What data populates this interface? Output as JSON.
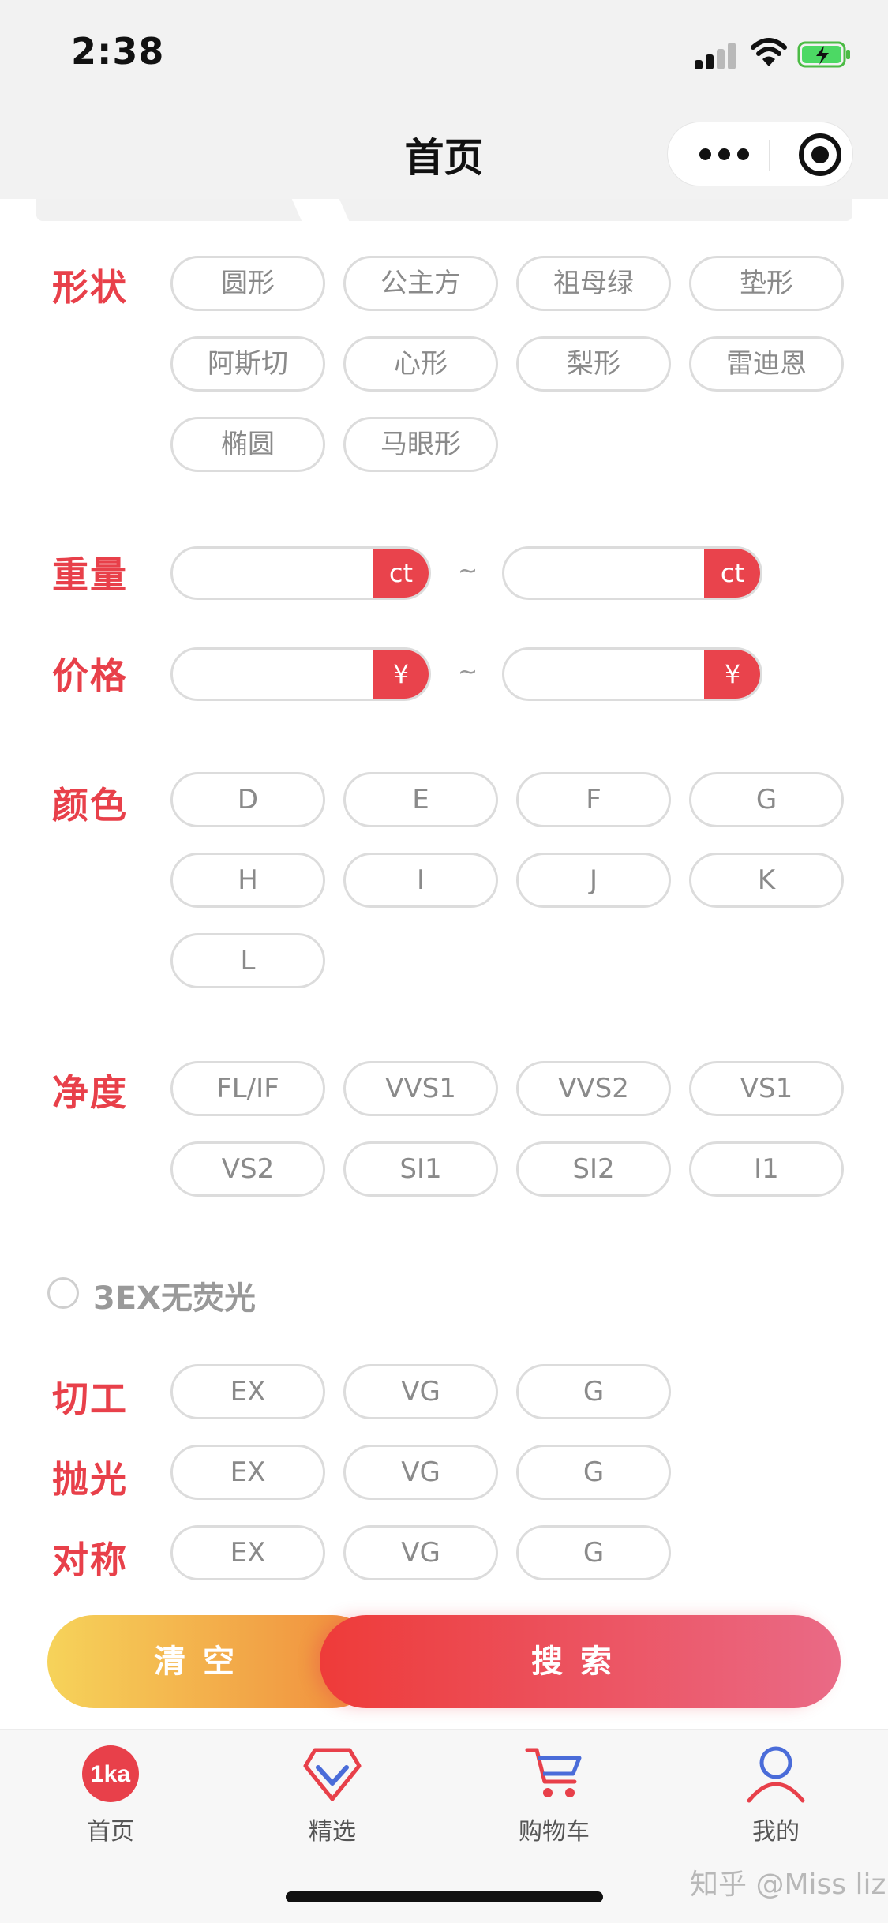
{
  "status_bar": {
    "time": "2:38"
  },
  "nav": {
    "title": "首页"
  },
  "sections": {
    "shape": {
      "label": "形状",
      "options": [
        "圆形",
        "公主方",
        "祖母绿",
        "垫形",
        "阿斯切",
        "心形",
        "梨形",
        "雷迪恩",
        "椭圆",
        "马眼形"
      ]
    },
    "weight": {
      "label": "重量",
      "unit": "ct",
      "separator": "~"
    },
    "price": {
      "label": "价格",
      "unit": "¥",
      "separator": "~"
    },
    "color": {
      "label": "颜色",
      "options": [
        "D",
        "E",
        "F",
        "G",
        "H",
        "I",
        "J",
        "K",
        "L"
      ]
    },
    "clarity": {
      "label": "净度",
      "options": [
        "FL/IF",
        "VVS1",
        "VVS2",
        "VS1",
        "VS2",
        "SI1",
        "SI2",
        "I1"
      ]
    },
    "fluorescence": {
      "label": "3EX无荧光"
    },
    "cut": {
      "label": "切工",
      "options": [
        "EX",
        "VG",
        "G"
      ]
    },
    "polish": {
      "label": "抛光",
      "options": [
        "EX",
        "VG",
        "G"
      ]
    },
    "symmetry": {
      "label": "对称",
      "options": [
        "EX",
        "VG",
        "G"
      ]
    }
  },
  "actions": {
    "clear": "清空",
    "search": "搜索"
  },
  "tab_bar": {
    "items": [
      {
        "label": "首页",
        "icon": "home-logo-icon"
      },
      {
        "label": "精选",
        "icon": "diamond-icon"
      },
      {
        "label": "购物车",
        "icon": "cart-icon"
      },
      {
        "label": "我的",
        "icon": "user-icon"
      }
    ],
    "logo_text": "1ka"
  },
  "watermark": "知乎 @Miss liz",
  "colors": {
    "accent": "#e8404a",
    "clear_start": "#f6d35a",
    "clear_end": "#f08a3c",
    "search_start": "#ee3b39",
    "search_end": "#ea6a86"
  }
}
